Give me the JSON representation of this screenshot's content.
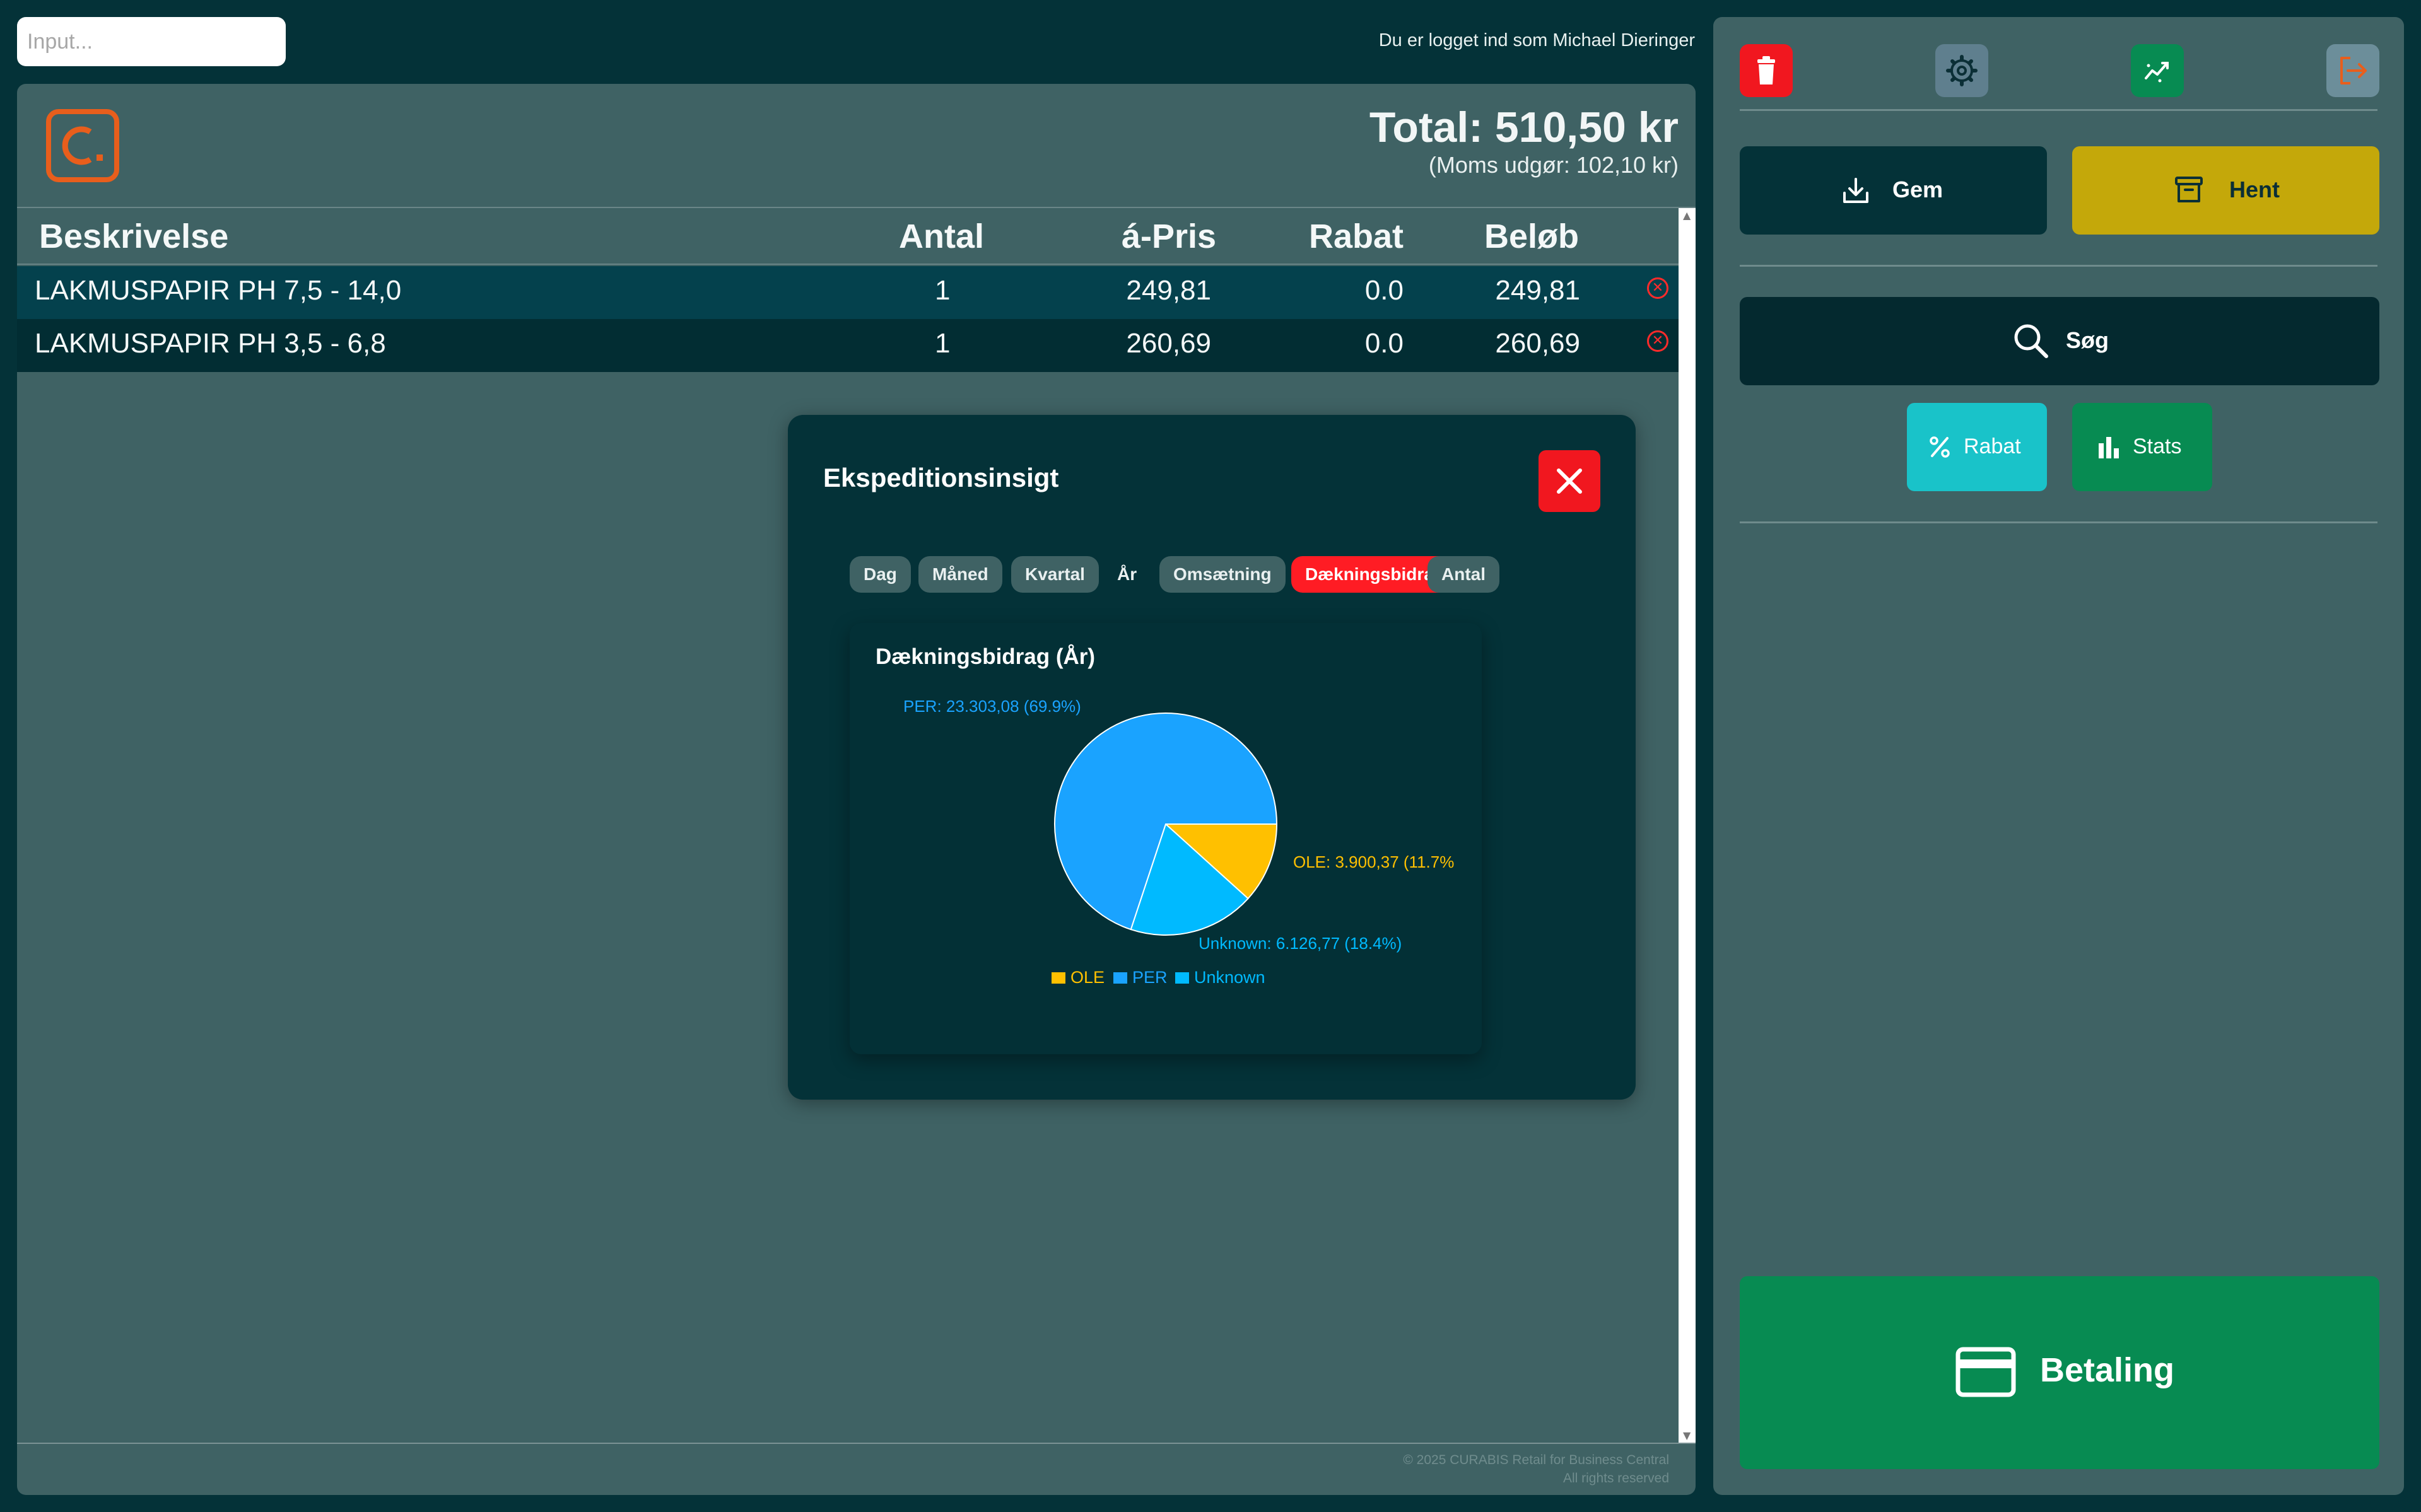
{
  "search": {
    "placeholder": "Input..."
  },
  "login_text": "Du er logget ind som Michael Dieringer",
  "receipt": {
    "total": "Total: 510,50 kr",
    "moms": "(Moms udgør: 102,10 kr)",
    "columns": [
      "Beskrivelse",
      "Antal",
      "á-Pris",
      "Rabat",
      "Beløb"
    ],
    "rows": [
      {
        "description": "LAKMUSPAPIR PH 7,5 - 14,0",
        "qty": "1",
        "price": "249,81",
        "discount": "0.0",
        "amount": "249,81"
      },
      {
        "description": "LAKMUSPAPIR PH 3,5 - 6,8",
        "qty": "1",
        "price": "260,69",
        "discount": "0.0",
        "amount": "260,69"
      }
    ]
  },
  "footer": {
    "line1": "© 2025 CURABIS Retail for Business Central",
    "line2": "All rights reserved"
  },
  "modal": {
    "title": "Ekspeditionsinsigt",
    "period_filters": [
      "Dag",
      "Måned",
      "Kvartal",
      "År"
    ],
    "metric_filters": [
      "Omsætning",
      "Dækningsbidrag",
      "Antal"
    ],
    "active_period": "År",
    "active_metric": "Dækningsbidrag"
  },
  "chart_data": {
    "type": "pie",
    "title": "Dækningsbidrag (År)",
    "slices": [
      {
        "name": "OLE",
        "value": 3900.37,
        "label": "OLE: 3.900,37 (11.7%",
        "color": "#ffc000"
      },
      {
        "name": "PER",
        "value": 23303.08,
        "label": "PER: 23.303,08 (69.9%)",
        "color": "#1aa3ff"
      },
      {
        "name": "Unknown",
        "value": 6126.77,
        "label": "Unknown: 6.126,77 (18.4%)",
        "color": "#00baff"
      }
    ],
    "legend": [
      "OLE",
      "PER",
      "Unknown"
    ],
    "legend_position": "bottom"
  },
  "actions": {
    "gem": "Gem",
    "hent": "Hent",
    "search": "Søg",
    "rabat": "Rabat",
    "stats": "Stats",
    "payment": "Betaling"
  },
  "colors": {
    "background": "#043238",
    "panel": "#3f6264",
    "accent_red": "#f1171f",
    "accent_yellow": "#c4a80a",
    "accent_green": "#078b52",
    "accent_cyan": "#19c3c9",
    "logo_orange": "#e85e1c"
  }
}
